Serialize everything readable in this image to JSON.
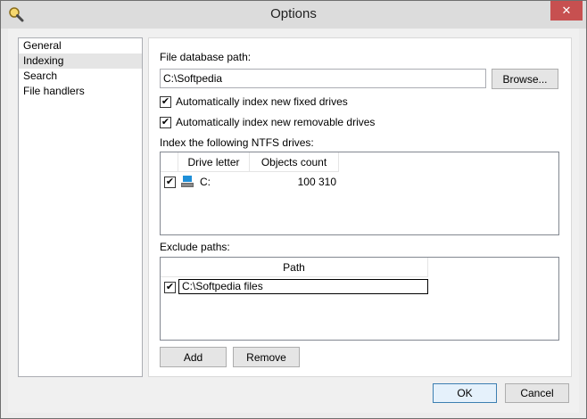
{
  "window": {
    "title": "Options",
    "close_symbol": "✕",
    "app_icon": "magnifier-icon"
  },
  "nav": {
    "items": [
      {
        "label": "General",
        "selected": false
      },
      {
        "label": "Indexing",
        "selected": true
      },
      {
        "label": "Search",
        "selected": false
      },
      {
        "label": "File handlers",
        "selected": false
      }
    ]
  },
  "indexing": {
    "db_path_label": "File database path:",
    "db_path_value": "C:\\Softpedia",
    "browse_label": "Browse...",
    "auto_fixed": {
      "label": "Automatically index new fixed drives",
      "checked": true
    },
    "auto_removable": {
      "label": "Automatically index new removable drives",
      "checked": true
    },
    "ntfs_label": "Index the following NTFS drives:",
    "drives_table": {
      "columns": [
        "Drive letter",
        "Objects count"
      ],
      "rows": [
        {
          "checked": true,
          "icon": "drive-icon",
          "letter": "C:",
          "count": "100 310"
        }
      ]
    },
    "exclude_label": "Exclude paths:",
    "exclude_table": {
      "columns": [
        "Path"
      ],
      "rows": [
        {
          "checked": true,
          "path": "C:\\Softpedia files"
        }
      ]
    },
    "add_label": "Add",
    "remove_label": "Remove"
  },
  "footer": {
    "ok_label": "OK",
    "cancel_label": "Cancel"
  },
  "check_mark": "✔"
}
